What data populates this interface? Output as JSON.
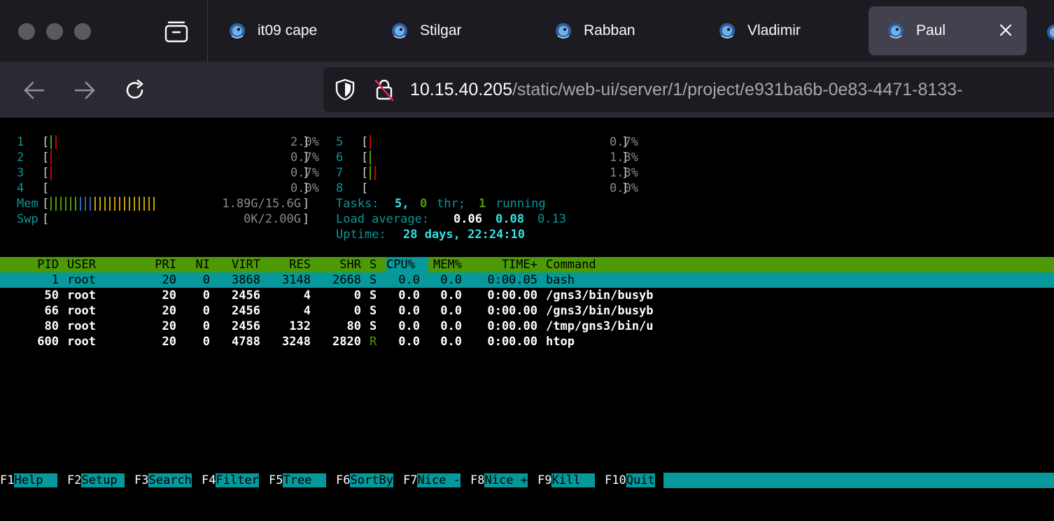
{
  "browser": {
    "tabs": [
      {
        "label": "it09 cape",
        "active": false
      },
      {
        "label": "Stilgar",
        "active": false
      },
      {
        "label": "Rabban",
        "active": false
      },
      {
        "label": "Vladimir",
        "active": false
      },
      {
        "label": "Paul",
        "active": true
      }
    ],
    "icons": {
      "tab_favicon": "gns3-chameleon-icon",
      "tab_close": "close-icon",
      "overview": "tab-overview-icon",
      "back": "arrow-left-icon",
      "forward": "arrow-right-icon",
      "reload": "reload-icon",
      "shield": "shield-icon",
      "lock": "insecure-lock-icon"
    },
    "url": {
      "host": "10.15.40.205",
      "path": "/static/web-ui/server/1/project/e931ba6b-0e83-4471-8133-"
    }
  },
  "htop": {
    "cpus": [
      {
        "n": "1",
        "pct": "2.0%",
        "bars": [
          "green",
          "red"
        ]
      },
      {
        "n": "2",
        "pct": "0.7%",
        "bars": [
          "red"
        ]
      },
      {
        "n": "3",
        "pct": "0.7%",
        "bars": [
          "red"
        ]
      },
      {
        "n": "4",
        "pct": "0.0%",
        "bars": []
      },
      {
        "n": "5",
        "pct": "0.7%",
        "bars": [
          "red"
        ]
      },
      {
        "n": "6",
        "pct": "1.3%",
        "bars": [
          "green"
        ]
      },
      {
        "n": "7",
        "pct": "1.3%",
        "bars": [
          "green",
          "red"
        ]
      },
      {
        "n": "8",
        "pct": "0.0%",
        "bars": []
      }
    ],
    "mem": {
      "label": "Mem",
      "value": "1.89G/15.6G"
    },
    "swp": {
      "label": "Swp",
      "value": "0K/2.00G"
    },
    "tasks": {
      "label": "Tasks:",
      "count": "5,",
      "thr": "0",
      "thr_label": "thr;",
      "running": "1",
      "running_label": "running"
    },
    "load": {
      "label": "Load average:",
      "v1": "0.06",
      "v5": "0.08",
      "v15": "0.13"
    },
    "uptime": {
      "label": "Uptime:",
      "value": "28 days, 22:24:10"
    },
    "columns": [
      "PID",
      "USER",
      "PRI",
      "NI",
      "VIRT",
      "RES",
      "SHR",
      "S",
      "CPU%",
      "MEM%",
      "TIME+",
      "Command"
    ],
    "processes": [
      {
        "pid": "1",
        "user": "root",
        "pri": "20",
        "ni": "0",
        "virt": "3868",
        "res": "3148",
        "shr": "2668",
        "s": "S",
        "cpu": "0.0",
        "mem": "0.0",
        "time": "0:00.05",
        "cmd": "bash"
      },
      {
        "pid": "50",
        "user": "root",
        "pri": "20",
        "ni": "0",
        "virt": "2456",
        "res": "4",
        "shr": "0",
        "s": "S",
        "cpu": "0.0",
        "mem": "0.0",
        "time": "0:00.00",
        "cmd": "/gns3/bin/busyb"
      },
      {
        "pid": "66",
        "user": "root",
        "pri": "20",
        "ni": "0",
        "virt": "2456",
        "res": "4",
        "shr": "0",
        "s": "S",
        "cpu": "0.0",
        "mem": "0.0",
        "time": "0:00.00",
        "cmd": "/gns3/bin/busyb"
      },
      {
        "pid": "80",
        "user": "root",
        "pri": "20",
        "ni": "0",
        "virt": "2456",
        "res": "132",
        "shr": "80",
        "s": "S",
        "cpu": "0.0",
        "mem": "0.0",
        "time": "0:00.00",
        "cmd": "/tmp/gns3/bin/u"
      },
      {
        "pid": "600",
        "user": "root",
        "pri": "20",
        "ni": "0",
        "virt": "4788",
        "res": "3248",
        "shr": "2820",
        "s": "R",
        "cpu": "0.0",
        "mem": "0.0",
        "time": "0:00.00",
        "cmd": "htop"
      }
    ],
    "fkeys": [
      {
        "key": "F1",
        "label": "Help  "
      },
      {
        "key": "F2",
        "label": "Setup "
      },
      {
        "key": "F3",
        "label": "Search"
      },
      {
        "key": "F4",
        "label": "Filter"
      },
      {
        "key": "F5",
        "label": "Tree  "
      },
      {
        "key": "F6",
        "label": "SortBy"
      },
      {
        "key": "F7",
        "label": "Nice -"
      },
      {
        "key": "F8",
        "label": "Nice +"
      },
      {
        "key": "F9",
        "label": "Kill  "
      },
      {
        "key": "F10",
        "label": "Quit"
      }
    ],
    "colors": {
      "header_bg": "#4e9a06",
      "selected_bg": "#06989a",
      "cyan": "#06989a"
    }
  }
}
